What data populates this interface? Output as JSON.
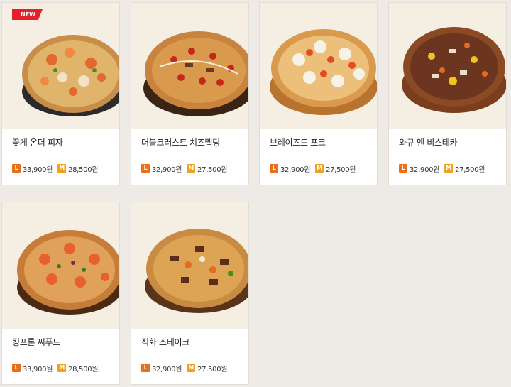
{
  "badge": "NEW",
  "size_labels": {
    "large": "L",
    "medium": "M"
  },
  "products": [
    {
      "name": "꽃게 온더 피자",
      "price_l": "33,900원",
      "price_m": "28,500원",
      "icon": "pizza-crab-image"
    },
    {
      "name": "더블크러스트 치즈멜팅",
      "price_l": "32,900원",
      "price_m": "27,500원",
      "icon": "pizza-double-crust-image"
    },
    {
      "name": "브레이즈드 포크",
      "price_l": "32,900원",
      "price_m": "27,500원",
      "icon": "pizza-braised-pork-image"
    },
    {
      "name": "와규 앤 비스테카",
      "price_l": "32,900원",
      "price_m": "27,500원",
      "icon": "pizza-wagyu-image"
    },
    {
      "name": "킹프론 씨푸드",
      "price_l": "33,900원",
      "price_m": "28,500원",
      "icon": "pizza-king-prawn-image"
    },
    {
      "name": "직화 스테이크",
      "price_l": "32,900원",
      "price_m": "27,500원",
      "icon": "pizza-steak-image"
    }
  ],
  "colors": {
    "large_tag": "#e8701a",
    "medium_tag": "#f0a21c",
    "new_badge": "#e4202b"
  }
}
